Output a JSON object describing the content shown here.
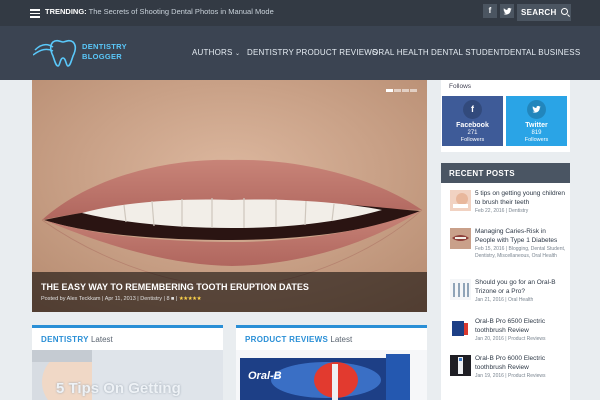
{
  "topbar": {
    "trending_label": "TRENDING:",
    "trending_text": "The Secrets of Shooting Dental Photos in Manual Mode",
    "facebook_glyph": "f",
    "twitter_glyph": "🐦",
    "search_label": "SEARCH"
  },
  "header": {
    "logo_line1": "DENTISTRY",
    "logo_line2": "BLOGGER",
    "nav": [
      "AUTHORS",
      "DENTISTRY",
      "PRODUCT REVIEWS",
      "ORAL HEALTH",
      "DENTAL STUDENT",
      "DENTAL BUSINESS"
    ]
  },
  "hero": {
    "title": "THE EASY WAY TO REMEMBERING TOOTH ERUPTION DATES",
    "meta": "Posted by Alex Teckkam | Apr 11, 2013 | Dentistry | 8 ■ |",
    "rating": 4.5,
    "stars": "★★★★★"
  },
  "follows": {
    "label": "Follows",
    "facebook": {
      "name": "Facebook",
      "count": "271",
      "sub": "Followers"
    },
    "twitter": {
      "name": "Twitter",
      "count": "819",
      "sub": "Followers"
    }
  },
  "recent": {
    "heading": "RECENT POSTS",
    "posts": [
      {
        "title": "5 tips on getting young children to brush their teeth",
        "meta": "Feb 22, 2016 | Dentistry"
      },
      {
        "title": "Managing Caries-Risk in People with Type 1 Diabetes",
        "meta": "Feb 15, 2016 | Blogging, Dental Student, Dentistry, Miscellaneous, Oral Health"
      },
      {
        "title": "Should you go for an Oral-B Trizone or a Pro?",
        "meta": "Jan 21, 2016 | Oral Health"
      },
      {
        "title": "Oral-B Pro 6500 Electric toothbrush Review",
        "meta": "Jan 20, 2016 | Product Reviews"
      },
      {
        "title": "Oral-B Pro 6000 Electric toothbrush Review",
        "meta": "Jan 19, 2016 | Product Reviews"
      }
    ]
  },
  "panels": {
    "left": {
      "category": "DENTISTRY",
      "suffix": "Latest",
      "img_text": "5 Tips On Getting"
    },
    "right": {
      "category": "PRODUCT REVIEWS",
      "suffix": "Latest",
      "img_text": "Oral-B"
    }
  },
  "colors": {
    "topbar": "#333a44",
    "header": "#3b4452",
    "accent": "#2a8fd6",
    "facebook": "#3e5b98",
    "twitter": "#2aa4e6"
  }
}
